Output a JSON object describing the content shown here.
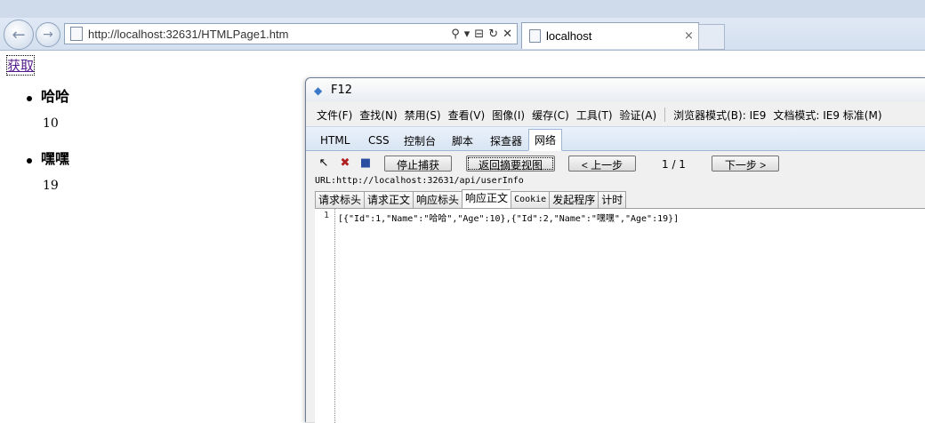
{
  "browser": {
    "url": "http://localhost:32631/HTMLPage1.htm",
    "tab_label": "localhost",
    "tab_close": "×",
    "back_glyph": "←",
    "forward_glyph": "→",
    "addr_search_glyph": "⚲",
    "addr_dropdown_glyph": "▾",
    "addr_compat_glyph": "⊟",
    "addr_refresh_glyph": "↻",
    "addr_stop_glyph": "✕"
  },
  "page": {
    "fetch_link": "获取",
    "people": [
      {
        "name": "哈哈",
        "age": "10"
      },
      {
        "name": "嘿嘿",
        "age": "19"
      }
    ]
  },
  "devtools": {
    "title": "F12",
    "menu": [
      "文件(F)",
      "查找(N)",
      "禁用(S)",
      "查看(V)",
      "图像(I)",
      "缓存(C)",
      "工具(T)",
      "验证(A)"
    ],
    "browser_mode_label": "浏览器模式(B):",
    "browser_mode_value": "IE9",
    "doc_mode_label": "文档模式:",
    "doc_mode_value": "IE9 标准(M)",
    "tabs": [
      "HTML",
      "CSS",
      "控制台",
      "脚本",
      "探查器",
      "网络"
    ],
    "active_tab": "网络",
    "toolbar": {
      "stop_capture": "停止捕获",
      "return_summary": "返回摘要视图",
      "prev": "< 上一步",
      "page_indicator": "1 / 1",
      "next": "下一步 >"
    },
    "request_url": "URL:http://localhost:32631/api/userInfo",
    "detail_tabs": [
      "请求标头",
      "请求正文",
      "响应标头",
      "响应正文",
      "Cookie",
      "发起程序",
      "计时"
    ],
    "active_detail_tab": "响应正文",
    "response_line_number": "1",
    "response_body": "[{\"Id\":1,\"Name\":\"哈哈\",\"Age\":10},{\"Id\":2,\"Name\":\"嘿嘿\",\"Age\":19}]"
  }
}
